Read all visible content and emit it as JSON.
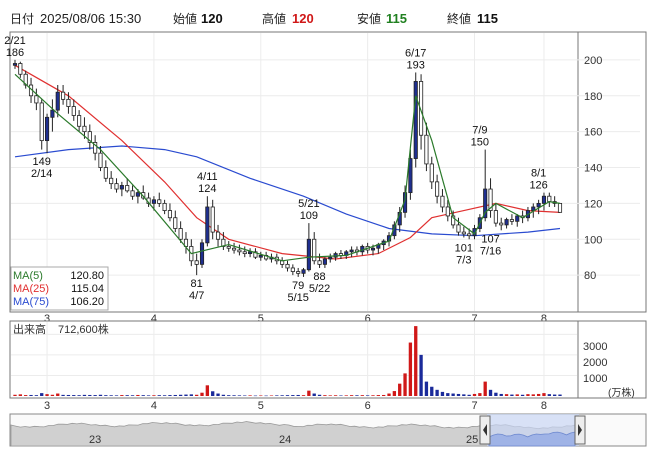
{
  "header": {
    "date_label": "日付",
    "datetime": "2025/08/06 15:30",
    "open_label": "始値",
    "open": "120",
    "high_label": "高値",
    "high": "120",
    "low_label": "安値",
    "low": "115",
    "close_label": "終値",
    "close": "115"
  },
  "colors": {
    "up": "#1f2f8f",
    "down": "#ffffff",
    "ma5": "#2b7a2b",
    "ma25": "#e03030",
    "ma75": "#2a4bd0",
    "vol_up": "#d01818",
    "vol_down": "#1a2a9a",
    "high_text": "#d01818",
    "low_text": "#208020",
    "frame": "#666666"
  },
  "legend": [
    {
      "name": "MA(5)",
      "value": "120.80",
      "color": "#2b7a2b"
    },
    {
      "name": "MA(25)",
      "value": "115.04",
      "color": "#e03030"
    },
    {
      "name": "MA(75)",
      "value": "106.20",
      "color": "#2a4bd0"
    }
  ],
  "volume_panel": {
    "label": "出来高",
    "value": "712,600株",
    "unit": "(万株)",
    "ticks": [
      "3000",
      "2000",
      "1000"
    ]
  },
  "navigator": {
    "labels": [
      "23",
      "24",
      "25"
    ]
  },
  "chart_data": {
    "type": "candlestick",
    "ylim": [
      60,
      215
    ],
    "y_ticks": [
      80,
      100,
      120,
      140,
      160,
      180,
      200
    ],
    "x_ticks": [
      "3",
      "4",
      "5",
      "6",
      "7",
      "8"
    ],
    "candles": [
      [
        197,
        200,
        195,
        198
      ],
      [
        198,
        199,
        190,
        192
      ],
      [
        192,
        194,
        184,
        186
      ],
      [
        186,
        190,
        176,
        180
      ],
      [
        180,
        184,
        172,
        176
      ],
      [
        176,
        178,
        150,
        155
      ],
      [
        155,
        170,
        148,
        168
      ],
      [
        168,
        178,
        160,
        172
      ],
      [
        172,
        186,
        168,
        182
      ],
      [
        182,
        186,
        175,
        178
      ],
      [
        178,
        182,
        170,
        174
      ],
      [
        174,
        178,
        166,
        169
      ],
      [
        169,
        172,
        160,
        163
      ],
      [
        163,
        168,
        156,
        160
      ],
      [
        160,
        164,
        150,
        154
      ],
      [
        154,
        158,
        144,
        148
      ],
      [
        148,
        152,
        138,
        140
      ],
      [
        140,
        144,
        132,
        134
      ],
      [
        134,
        138,
        128,
        131
      ],
      [
        131,
        134,
        126,
        128
      ],
      [
        128,
        132,
        124,
        130
      ],
      [
        130,
        134,
        126,
        127
      ],
      [
        127,
        130,
        122,
        124
      ],
      [
        124,
        128,
        120,
        126
      ],
      [
        126,
        130,
        122,
        123
      ],
      [
        123,
        126,
        118,
        120
      ],
      [
        120,
        124,
        116,
        122
      ],
      [
        122,
        126,
        118,
        120
      ],
      [
        120,
        122,
        114,
        116
      ],
      [
        116,
        120,
        110,
        112
      ],
      [
        112,
        116,
        104,
        106
      ],
      [
        106,
        110,
        98,
        100
      ],
      [
        100,
        104,
        92,
        96
      ],
      [
        96,
        100,
        85,
        88
      ],
      [
        88,
        92,
        80,
        86
      ],
      [
        86,
        100,
        84,
        98
      ],
      [
        98,
        124,
        96,
        118
      ],
      [
        118,
        122,
        100,
        104
      ],
      [
        104,
        108,
        96,
        100
      ],
      [
        100,
        104,
        94,
        96
      ],
      [
        96,
        99,
        93,
        95
      ],
      [
        95,
        98,
        92,
        94
      ],
      [
        94,
        97,
        91,
        93
      ],
      [
        93,
        96,
        90,
        92
      ],
      [
        92,
        95,
        90,
        93
      ],
      [
        93,
        95,
        89,
        90
      ],
      [
        90,
        93,
        88,
        91
      ],
      [
        91,
        93,
        88,
        89
      ],
      [
        89,
        92,
        87,
        90
      ],
      [
        90,
        92,
        86,
        88
      ],
      [
        88,
        90,
        84,
        86
      ],
      [
        86,
        88,
        82,
        84
      ],
      [
        84,
        86,
        80,
        82
      ],
      [
        82,
        84,
        79,
        81
      ],
      [
        81,
        84,
        79,
        83
      ],
      [
        83,
        109,
        82,
        100
      ],
      [
        100,
        104,
        86,
        88
      ],
      [
        88,
        92,
        84,
        86
      ],
      [
        86,
        90,
        84,
        89
      ],
      [
        89,
        92,
        87,
        90
      ],
      [
        90,
        93,
        88,
        92
      ],
      [
        92,
        94,
        89,
        91
      ],
      [
        91,
        94,
        89,
        93
      ],
      [
        93,
        96,
        90,
        94
      ],
      [
        94,
        96,
        91,
        93
      ],
      [
        93,
        97,
        91,
        96
      ],
      [
        96,
        98,
        92,
        94
      ],
      [
        94,
        97,
        91,
        95
      ],
      [
        95,
        98,
        92,
        97
      ],
      [
        97,
        100,
        94,
        99
      ],
      [
        99,
        104,
        96,
        102
      ],
      [
        102,
        110,
        100,
        108
      ],
      [
        108,
        118,
        104,
        115
      ],
      [
        115,
        130,
        112,
        126
      ],
      [
        126,
        150,
        122,
        145
      ],
      [
        145,
        193,
        140,
        188
      ],
      [
        188,
        192,
        150,
        158
      ],
      [
        158,
        165,
        138,
        142
      ],
      [
        142,
        146,
        128,
        132
      ],
      [
        132,
        136,
        120,
        124
      ],
      [
        124,
        128,
        115,
        118
      ],
      [
        118,
        122,
        110,
        113
      ],
      [
        113,
        116,
        106,
        108
      ],
      [
        108,
        112,
        102,
        104
      ],
      [
        104,
        107,
        101,
        103
      ],
      [
        103,
        106,
        100,
        102
      ],
      [
        102,
        108,
        100,
        106
      ],
      [
        106,
        114,
        104,
        112
      ],
      [
        112,
        150,
        110,
        128
      ],
      [
        128,
        134,
        112,
        116
      ],
      [
        116,
        120,
        107,
        109
      ],
      [
        109,
        112,
        105,
        108
      ],
      [
        108,
        112,
        106,
        111
      ],
      [
        111,
        114,
        108,
        110
      ],
      [
        110,
        114,
        107,
        113
      ],
      [
        113,
        116,
        109,
        112
      ],
      [
        112,
        118,
        110,
        116
      ],
      [
        116,
        120,
        112,
        118
      ],
      [
        118,
        122,
        114,
        120
      ],
      [
        120,
        126,
        116,
        124
      ],
      [
        124,
        126,
        118,
        121
      ],
      [
        121,
        124,
        118,
        120
      ],
      [
        120,
        120,
        115,
        115
      ]
    ],
    "ma5": [
      [
        0,
        192
      ],
      [
        8,
        170
      ],
      [
        16,
        150
      ],
      [
        24,
        124
      ],
      [
        33,
        92
      ],
      [
        40,
        97
      ],
      [
        50,
        88
      ],
      [
        55,
        90
      ],
      [
        62,
        91
      ],
      [
        70,
        99
      ],
      [
        73,
        122
      ],
      [
        75,
        180
      ],
      [
        78,
        155
      ],
      [
        82,
        112
      ],
      [
        86,
        103
      ],
      [
        88,
        115
      ],
      [
        90,
        120
      ],
      [
        95,
        112
      ],
      [
        100,
        121
      ],
      [
        102,
        120
      ]
    ],
    "ma25": [
      [
        0,
        197
      ],
      [
        10,
        180
      ],
      [
        20,
        155
      ],
      [
        28,
        132
      ],
      [
        34,
        112
      ],
      [
        40,
        100
      ],
      [
        50,
        92
      ],
      [
        60,
        89
      ],
      [
        68,
        92
      ],
      [
        74,
        101
      ],
      [
        78,
        112
      ],
      [
        84,
        116
      ],
      [
        90,
        120
      ],
      [
        96,
        116
      ],
      [
        102,
        115
      ]
    ],
    "ma75": [
      [
        0,
        146
      ],
      [
        10,
        150
      ],
      [
        20,
        152
      ],
      [
        28,
        150
      ],
      [
        34,
        146
      ],
      [
        44,
        134
      ],
      [
        54,
        124
      ],
      [
        62,
        114
      ],
      [
        70,
        106
      ],
      [
        78,
        103
      ],
      [
        86,
        102
      ],
      [
        96,
        104
      ],
      [
        102,
        106
      ]
    ],
    "annotations": [
      {
        "i": 0,
        "v": 200,
        "label": "2/21\n186",
        "pos": "above"
      },
      {
        "i": 5,
        "v": 148,
        "label": "149\n2/14",
        "pos": "below"
      },
      {
        "i": 36,
        "v": 124,
        "label": "4/11\n124",
        "pos": "above"
      },
      {
        "i": 34,
        "v": 80,
        "label": "81\n4/7",
        "pos": "below"
      },
      {
        "i": 55,
        "v": 109,
        "label": "5/21\n109",
        "pos": "above"
      },
      {
        "i": 53,
        "v": 79,
        "label": "79\n5/15",
        "pos": "below"
      },
      {
        "i": 57,
        "v": 84,
        "label": "88\n5/22",
        "pos": "below"
      },
      {
        "i": 75,
        "v": 193,
        "label": "6/17\n193",
        "pos": "above"
      },
      {
        "i": 87,
        "v": 150,
        "label": "7/9\n150",
        "pos": "above"
      },
      {
        "i": 84,
        "v": 100,
        "label": "101\n7/3",
        "pos": "below"
      },
      {
        "i": 89,
        "v": 105,
        "label": "107\n7/16",
        "pos": "below"
      },
      {
        "i": 98,
        "v": 126,
        "label": "8/1\n126",
        "pos": "above"
      }
    ],
    "volume": [
      [
        60,
        1
      ],
      [
        80,
        1
      ],
      [
        45,
        1
      ],
      [
        50,
        0
      ],
      [
        40,
        0
      ],
      [
        140,
        0
      ],
      [
        90,
        1
      ],
      [
        60,
        1
      ],
      [
        120,
        1
      ],
      [
        55,
        0
      ],
      [
        50,
        0
      ],
      [
        45,
        0
      ],
      [
        40,
        0
      ],
      [
        55,
        0
      ],
      [
        50,
        0
      ],
      [
        45,
        0
      ],
      [
        60,
        0
      ],
      [
        40,
        0
      ],
      [
        35,
        0
      ],
      [
        30,
        0
      ],
      [
        45,
        1
      ],
      [
        40,
        0
      ],
      [
        35,
        0
      ],
      [
        50,
        1
      ],
      [
        40,
        0
      ],
      [
        30,
        0
      ],
      [
        35,
        1
      ],
      [
        40,
        0
      ],
      [
        35,
        0
      ],
      [
        45,
        0
      ],
      [
        50,
        0
      ],
      [
        60,
        0
      ],
      [
        70,
        0
      ],
      [
        80,
        0
      ],
      [
        60,
        1
      ],
      [
        160,
        1
      ],
      [
        520,
        1
      ],
      [
        230,
        0
      ],
      [
        120,
        0
      ],
      [
        60,
        0
      ],
      [
        40,
        0
      ],
      [
        35,
        0
      ],
      [
        30,
        0
      ],
      [
        25,
        0
      ],
      [
        30,
        1
      ],
      [
        20,
        0
      ],
      [
        25,
        1
      ],
      [
        20,
        0
      ],
      [
        25,
        1
      ],
      [
        30,
        0
      ],
      [
        35,
        0
      ],
      [
        40,
        0
      ],
      [
        45,
        0
      ],
      [
        50,
        0
      ],
      [
        40,
        1
      ],
      [
        260,
        1
      ],
      [
        120,
        0
      ],
      [
        60,
        0
      ],
      [
        40,
        1
      ],
      [
        30,
        1
      ],
      [
        35,
        1
      ],
      [
        25,
        0
      ],
      [
        30,
        1
      ],
      [
        40,
        1
      ],
      [
        35,
        0
      ],
      [
        40,
        1
      ],
      [
        30,
        0
      ],
      [
        35,
        1
      ],
      [
        45,
        1
      ],
      [
        50,
        1
      ],
      [
        120,
        1
      ],
      [
        240,
        1
      ],
      [
        600,
        1
      ],
      [
        1100,
        1
      ],
      [
        2600,
        1
      ],
      [
        3400,
        1
      ],
      [
        2000,
        0
      ],
      [
        700,
        0
      ],
      [
        450,
        0
      ],
      [
        300,
        0
      ],
      [
        200,
        0
      ],
      [
        140,
        0
      ],
      [
        120,
        0
      ],
      [
        100,
        0
      ],
      [
        80,
        0
      ],
      [
        60,
        0
      ],
      [
        100,
        1
      ],
      [
        140,
        1
      ],
      [
        700,
        1
      ],
      [
        300,
        0
      ],
      [
        160,
        0
      ],
      [
        100,
        0
      ],
      [
        90,
        1
      ],
      [
        70,
        0
      ],
      [
        80,
        1
      ],
      [
        60,
        0
      ],
      [
        90,
        1
      ],
      [
        80,
        1
      ],
      [
        100,
        1
      ],
      [
        140,
        1
      ],
      [
        90,
        0
      ],
      [
        70,
        0
      ],
      [
        71,
        0
      ]
    ]
  }
}
